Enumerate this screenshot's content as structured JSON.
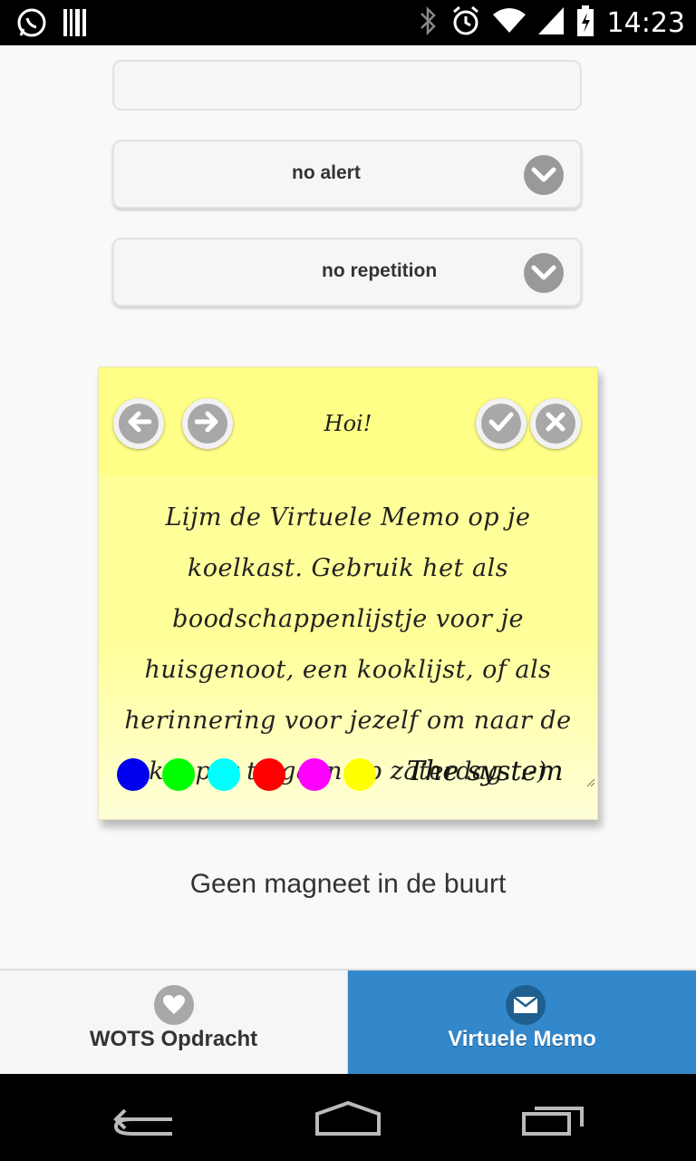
{
  "status_bar": {
    "time": "14:23"
  },
  "form": {
    "alert_select": {
      "value": "no alert"
    },
    "repeat_select": {
      "value": "no repetition"
    }
  },
  "memo": {
    "title": "Hoi!",
    "text": "Lijm de Virtuele Memo op je koelkast. Gebruik het als boodschappenlijstje voor je huisgenoot, een kooklijst, of als herinnering voor jezelf om naar de kapper te gaan op zaterdag. :-)",
    "signature": "The system",
    "colors": [
      "#0000ee",
      "#00ff00",
      "#00ffff",
      "#ff0000",
      "#ff00ff",
      "#ffff00"
    ]
  },
  "status_message": "Geen magneet in de buurt",
  "tabs": [
    {
      "label": "WOTS Opdracht",
      "icon": "heart-icon",
      "active": false
    },
    {
      "label": "Virtuele Memo",
      "icon": "mail-icon",
      "active": true
    }
  ],
  "colors": {
    "accent": "#3388cc",
    "memo": "#ffff99"
  }
}
